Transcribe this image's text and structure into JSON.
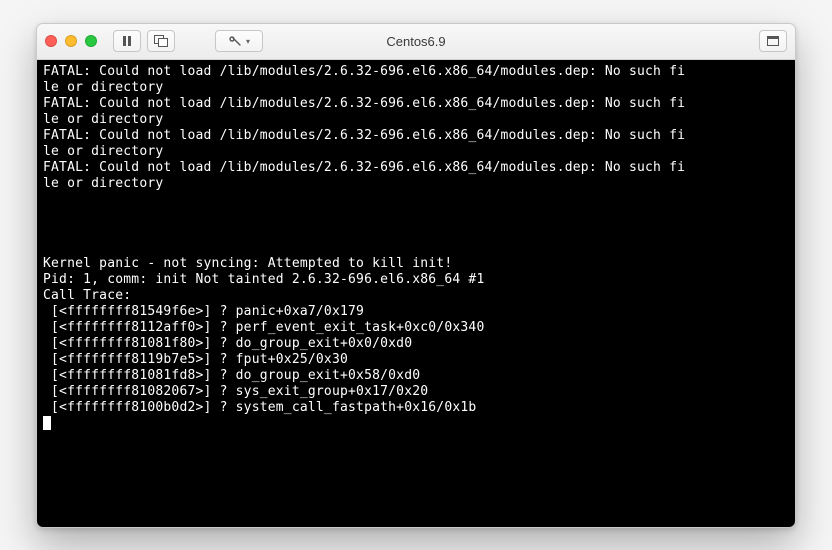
{
  "window": {
    "title": "Centos6.9",
    "traffic": {
      "close": "close",
      "minimize": "minimize",
      "zoom": "zoom"
    }
  },
  "toolbar": {
    "pause_icon": "pause",
    "snapshot_icon": "snapshot",
    "settings_icon": "settings",
    "fullscreen_icon": "fullscreen"
  },
  "terminal": {
    "lines": [
      "FATAL: Could not load /lib/modules/2.6.32-696.el6.x86_64/modules.dep: No such fi",
      "le or directory",
      "FATAL: Could not load /lib/modules/2.6.32-696.el6.x86_64/modules.dep: No such fi",
      "le or directory",
      "FATAL: Could not load /lib/modules/2.6.32-696.el6.x86_64/modules.dep: No such fi",
      "le or directory",
      "FATAL: Could not load /lib/modules/2.6.32-696.el6.x86_64/modules.dep: No such fi",
      "le or directory",
      "",
      "",
      "",
      "",
      "Kernel panic - not syncing: Attempted to kill init!",
      "Pid: 1, comm: init Not tainted 2.6.32-696.el6.x86_64 #1",
      "Call Trace:",
      " [<ffffffff81549f6e>] ? panic+0xa7/0x179",
      " [<ffffffff8112aff0>] ? perf_event_exit_task+0xc0/0x340",
      " [<ffffffff81081f80>] ? do_group_exit+0x0/0xd0",
      " [<ffffffff8119b7e5>] ? fput+0x25/0x30",
      " [<ffffffff81081fd8>] ? do_group_exit+0x58/0xd0",
      " [<ffffffff81082067>] ? sys_exit_group+0x17/0x20",
      " [<ffffffff8100b0d2>] ? system_call_fastpath+0x16/0x1b"
    ]
  }
}
